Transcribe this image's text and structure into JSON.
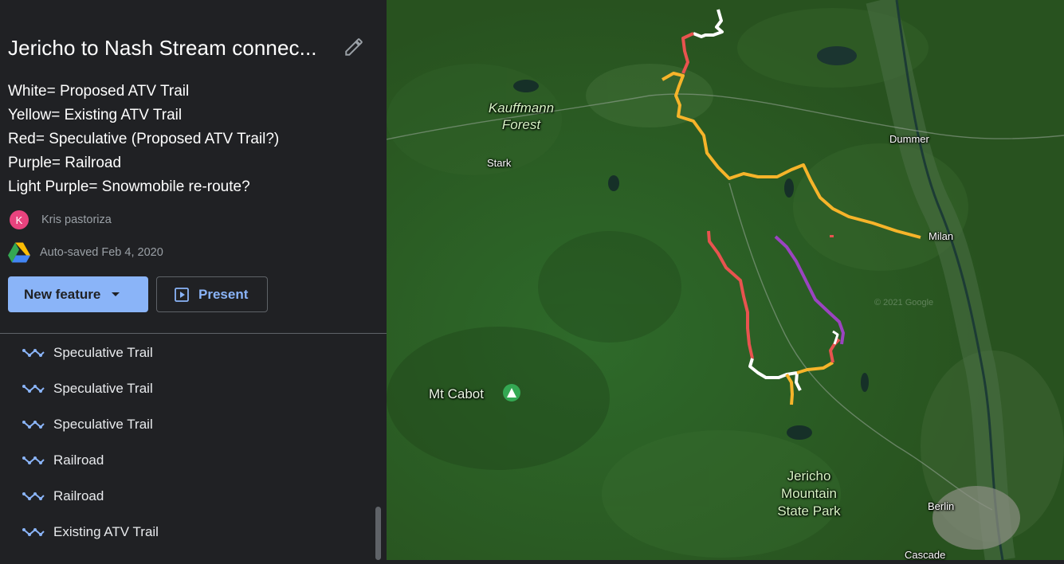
{
  "header": {
    "title": "Jericho to Nash Stream connec...",
    "edit_icon": "pencil-icon"
  },
  "description": [
    "White= Proposed ATV Trail",
    "Yellow= Existing ATV Trail",
    "Red= Speculative (Proposed ATV Trail?)",
    "Purple= Railroad",
    "Light Purple= Snowmobile re-route?"
  ],
  "owner": {
    "initial": "K",
    "name": "Kris pastoriza",
    "avatar_color": "#e8437e"
  },
  "saved": {
    "text": "Auto-saved Feb 4, 2020",
    "icon": "google-drive-icon"
  },
  "buttons": {
    "new_feature": "New feature",
    "present": "Present"
  },
  "layers": [
    {
      "label": "Speculative Trail",
      "icon": "line-icon"
    },
    {
      "label": "Speculative Trail",
      "icon": "line-icon"
    },
    {
      "label": "Speculative Trail",
      "icon": "line-icon"
    },
    {
      "label": "Railroad",
      "icon": "line-icon"
    },
    {
      "label": "Railroad",
      "icon": "line-icon"
    },
    {
      "label": "Existing ATV Trail",
      "icon": "line-icon"
    }
  ],
  "map": {
    "labels": {
      "kauffmann": "Kauffmann\nForest",
      "stark": "Stark",
      "dummer": "Dummer",
      "milan": "Milan",
      "mt_cabot": "Mt Cabot",
      "jericho": "Jericho\nMountain\nState Park",
      "berlin": "Berlin",
      "cascade": "Cascade"
    },
    "watermark": "© 2021 Google",
    "trail_colors": {
      "white": "#ffffff",
      "yellow": "#f6b42a",
      "red": "#e8534f",
      "purple": "#9b44c0"
    }
  },
  "colors": {
    "sidebar_bg": "#202124",
    "accent": "#8ab4f8",
    "map_base": "#2f5f27"
  }
}
